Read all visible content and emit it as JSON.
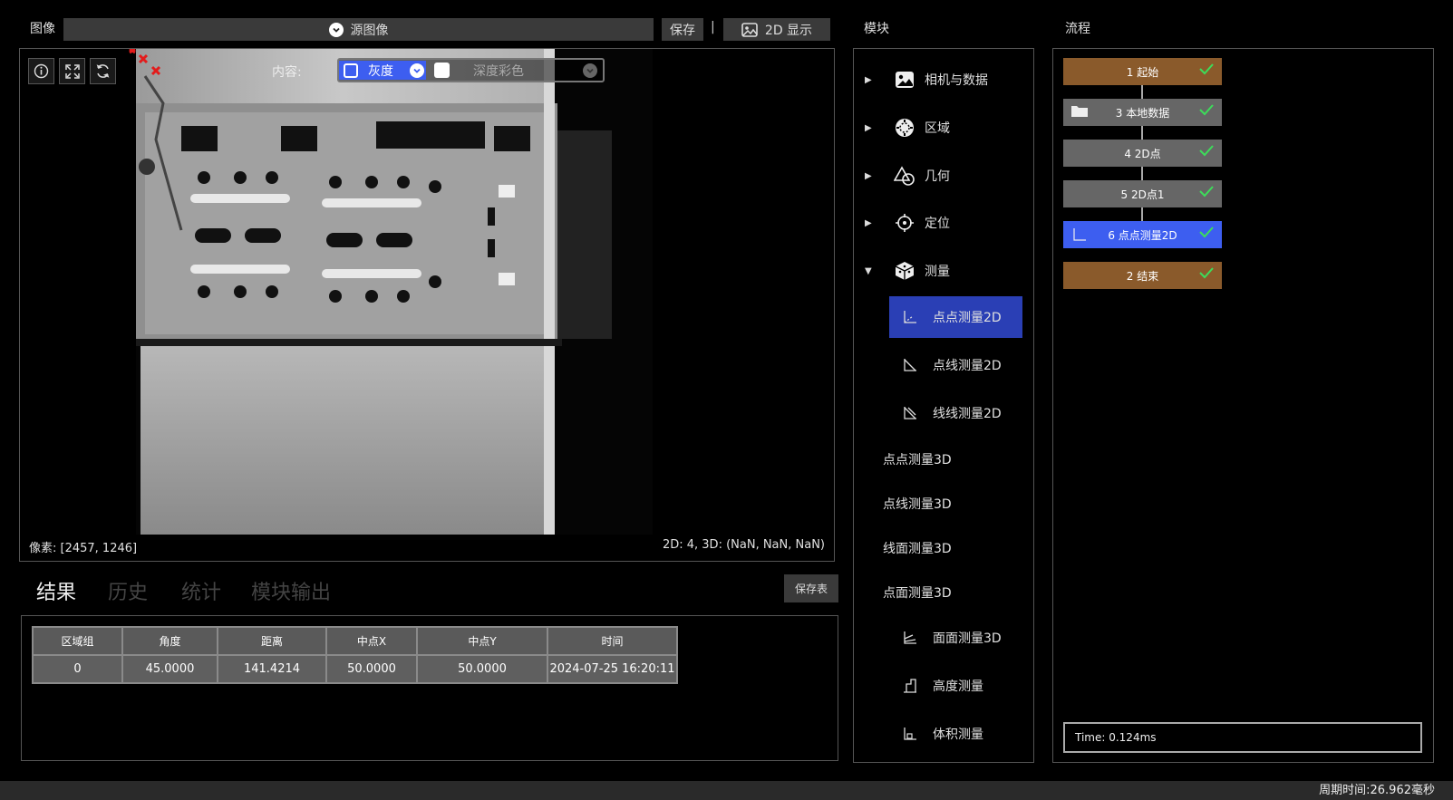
{
  "image_panel": {
    "title": "图像",
    "source_label": "源图像",
    "save_label": "保存",
    "separator": "|",
    "display_mode": "2D 显示",
    "content_label": "内容:",
    "gray_option": "灰度",
    "depth_option": "深度彩色",
    "pixel_readout": "像素: [2457, 1246]",
    "point_readout": "2D: 4, 3D: (NaN, NaN, NaN)"
  },
  "result_panel": {
    "tabs": [
      "结果",
      "历史",
      "统计",
      "模块输出"
    ],
    "save_table_label": "保存表",
    "columns": [
      "区域组",
      "角度",
      "距离",
      "中点X",
      "中点Y",
      "时间"
    ],
    "rows": [
      [
        "0",
        "45.0000",
        "141.4214",
        "50.0000",
        "50.0000",
        "2024-07-25 16:20:11"
      ]
    ]
  },
  "module_panel": {
    "title": "模块",
    "categories": [
      {
        "label": "相机与数据",
        "icon": "image-icon",
        "expanded": false
      },
      {
        "label": "区域",
        "icon": "region-icon",
        "expanded": false
      },
      {
        "label": "几何",
        "icon": "geometry-icon",
        "expanded": false
      },
      {
        "label": "定位",
        "icon": "crosshair-icon",
        "expanded": false
      },
      {
        "label": "测量",
        "icon": "cube-icon",
        "expanded": true
      }
    ],
    "items": [
      {
        "label": "点点测量2D",
        "selected": true
      },
      {
        "label": "点线测量2D"
      },
      {
        "label": "线线测量2D"
      },
      {
        "label": "点点测量3D"
      },
      {
        "label": "点线测量3D"
      },
      {
        "label": "线面测量3D"
      },
      {
        "label": "点面测量3D"
      },
      {
        "label": "面面测量3D"
      },
      {
        "label": "高度测量"
      },
      {
        "label": "体积测量"
      }
    ]
  },
  "flow_panel": {
    "title": "流程",
    "nodes": [
      {
        "label": "1 起始",
        "color": "#8a5a2b"
      },
      {
        "label": "3 本地数据",
        "color": "#666666"
      },
      {
        "label": "4 2D点",
        "color": "#666666"
      },
      {
        "label": "5 2D点1",
        "color": "#666666"
      },
      {
        "label": "6 点点测量2D",
        "color": "#3d5ef0"
      },
      {
        "label": "2 结束",
        "color": "#8a5a2b"
      }
    ],
    "time_text": "Time: 0.124ms"
  },
  "status_bar": {
    "cycle_time": "周期时间:26.962毫秒"
  },
  "colors": {
    "accent_blue": "#3d5ef0",
    "selected_item": "#2a3fb5",
    "check_green": "#3ddc5a",
    "brown_node": "#8a5a2b"
  }
}
